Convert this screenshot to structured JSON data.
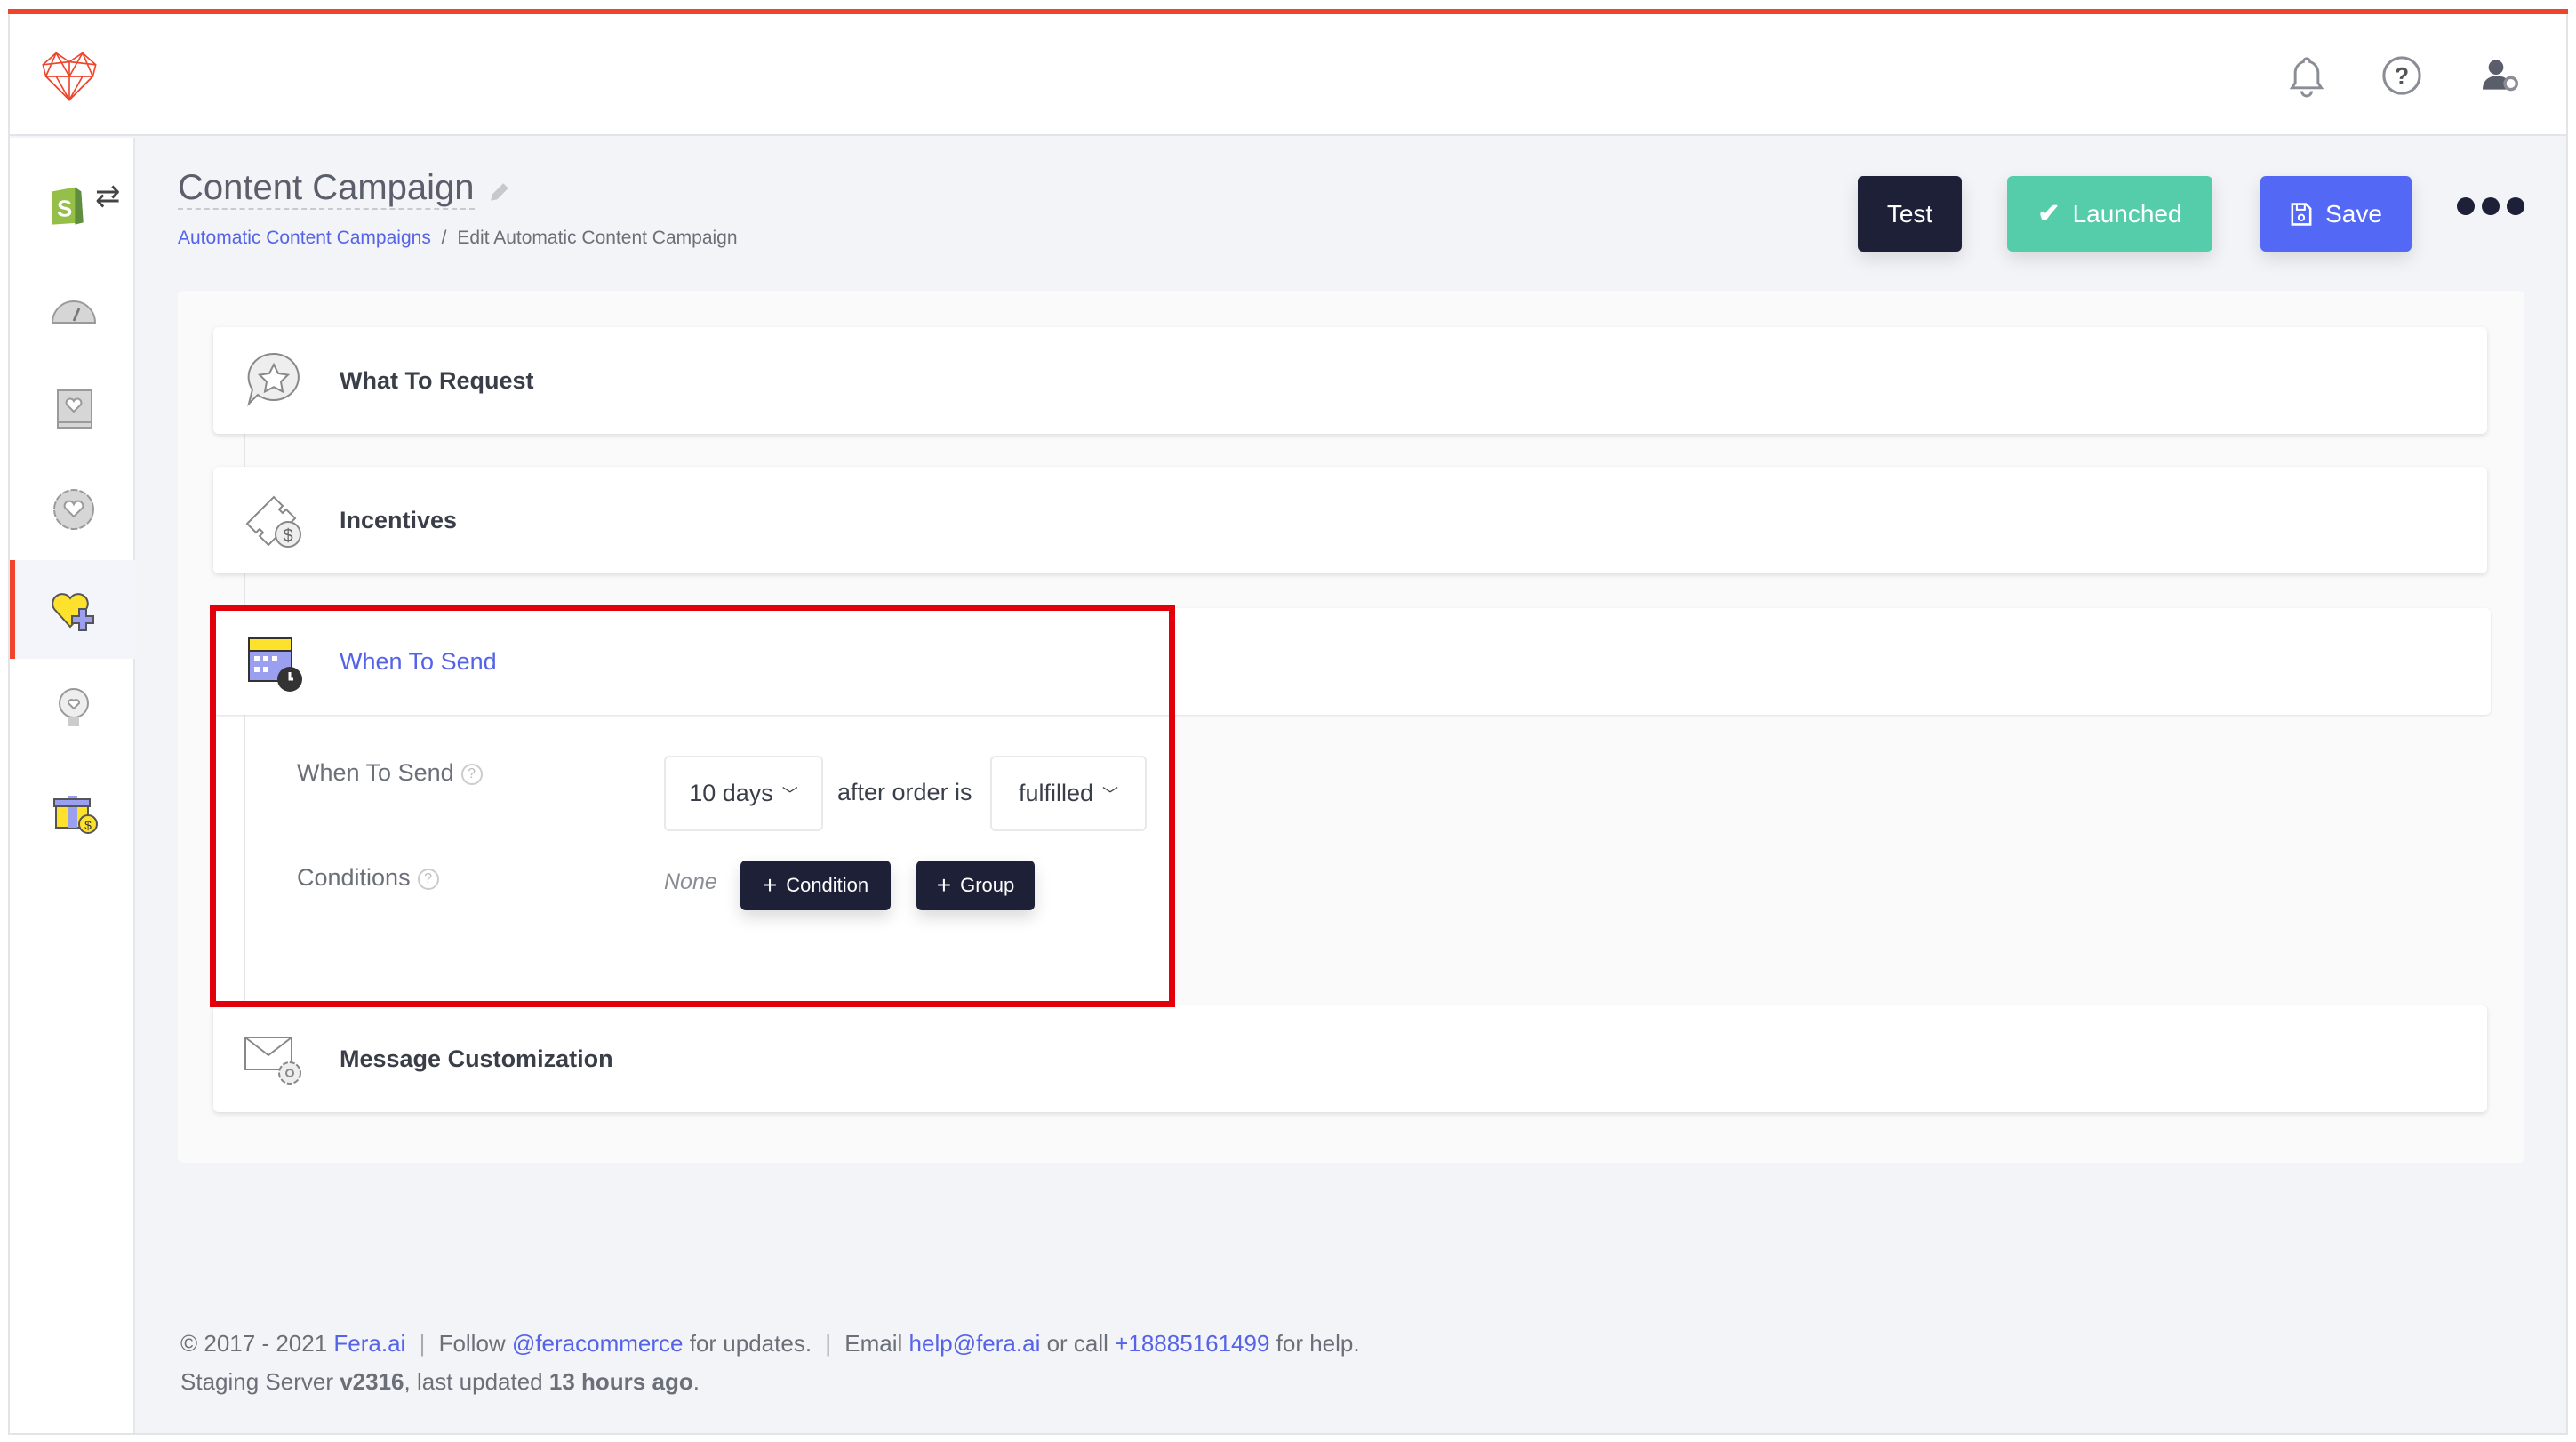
{
  "colors": {
    "brand": "#f0452c",
    "accent": "#5563e8",
    "launched": "#55cdab",
    "dark": "#1e2038",
    "highlight": "#e3000b"
  },
  "header": {
    "logo": "fera-heart-logo",
    "icons": [
      "bell-icon",
      "help-icon",
      "user-settings-icon"
    ]
  },
  "sidebar": {
    "items": [
      {
        "icon": "shopify-icon"
      },
      {
        "icon": "dashboard-icon"
      },
      {
        "icon": "reviews-book-icon"
      },
      {
        "icon": "badge-heart-icon"
      },
      {
        "icon": "heart-plus-icon",
        "active": true
      },
      {
        "icon": "lightbulb-heart-icon"
      },
      {
        "icon": "gift-icon"
      }
    ]
  },
  "page": {
    "title": "Content Campaign",
    "breadcrumb": {
      "link": "Automatic Content Campaigns",
      "sep": "/",
      "current": "Edit Automatic Content Campaign"
    }
  },
  "toolbar": {
    "test": "Test",
    "launched": "Launched",
    "save": "Save"
  },
  "panels": {
    "what": "What To Request",
    "incentives": "Incentives",
    "when": "When To Send",
    "message": "Message Customization"
  },
  "when_form": {
    "label": "When To Send",
    "delay": "10 days",
    "middle": "after order is",
    "status": "fulfilled",
    "conditions_label": "Conditions",
    "conditions_value": "None",
    "add_condition": "Condition",
    "add_group": "Group",
    "help": "?"
  },
  "footer": {
    "copy": "© 2017 - 2021",
    "brand": "Fera.ai",
    "sep": "|",
    "follow": "Follow",
    "handle": "@feracommerce",
    "follow_tail": "for updates.",
    "email_pre": "Email",
    "email": "help@fera.ai",
    "call": "or call",
    "phone": "+18885161499",
    "help_tail": "for help.",
    "server_pre": "Staging Server",
    "version": "v2316",
    "updated_pre": ", last updated",
    "updated": "13 hours ago",
    "dot": "."
  }
}
